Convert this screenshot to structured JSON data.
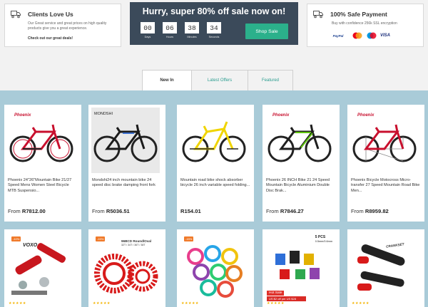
{
  "top": {
    "love": {
      "title": "Clients Love Us",
      "text": "Our Great service and great prices on high quality products give you a great experience.",
      "link": "Check out our great deals!",
      "icon": "truck-icon"
    },
    "sale": {
      "headline": "Hurry, super 80% off sale now on!",
      "countdown": [
        {
          "value": "00",
          "label": "Days"
        },
        {
          "value": "06",
          "label": "Hours"
        },
        {
          "value": "38",
          "label": "Minutes"
        },
        {
          "value": "34",
          "label": "Seconds"
        }
      ],
      "button": "Shop Sale"
    },
    "safe": {
      "title": "100% Safe Payment",
      "text": "Buy with confidence 256k SSL encryption",
      "payment": [
        "PayPal",
        "MasterCard",
        "Maestro",
        "VISA"
      ],
      "icon": "truck-icon"
    }
  },
  "tabs": [
    {
      "label": "New In",
      "active": true
    },
    {
      "label": "Latest Offers"
    },
    {
      "label": "Featured"
    }
  ],
  "products": [
    {
      "name": "Phoenix 24\"26\"Mountain Bike 21/27 Speed Mens Women Steel Bicycle MTB Suspensio...",
      "from": "From",
      "price": "R7812.00",
      "logo": "Phoenix"
    },
    {
      "name": "Mondshi24 inch mountain bike 24 speed disc brake damping front fork",
      "from": "From",
      "price": "R5036.51",
      "logo": "MONDSHI"
    },
    {
      "name": "Mountain road bike shock absorber bicycle 26 inch variable speed folding...",
      "from": "",
      "price": "R154.01"
    },
    {
      "name": "Phoenix 26 INCH Bike 21 24 Speed Mountain Bicycle Aluminium Double Disc Brak...",
      "from": "From",
      "price": "R7846.27",
      "logo": "Phoenix"
    },
    {
      "name": "Phoenix Bicycle Motocross Micro-transfer 27 Speed Mountain Road Bike Men...",
      "from": "From",
      "price": "R8959.82",
      "logo": "Phoenix"
    }
  ],
  "row2": [
    {
      "badge": "-10%",
      "title": "VOXO"
    },
    {
      "badge": "-15%",
      "title": "96BCD Round/Oval",
      "subtitle": "32T / 34T / 36T / 38T"
    },
    {
      "badge": "-15%"
    },
    {
      "title": "5 PCS",
      "subtitle": "0.5mm/0.6mm",
      "hot": "Hot Sale",
      "hotsub": "US $2 off per US $28"
    },
    {
      "title": "CRANKSET"
    }
  ],
  "stars": "★★★★★",
  "colors": {
    "accent": "#2bb08b",
    "banner": "#3b4a5a",
    "products_bg": "#a9cbd8",
    "tab_link": "#2a9d8f"
  }
}
